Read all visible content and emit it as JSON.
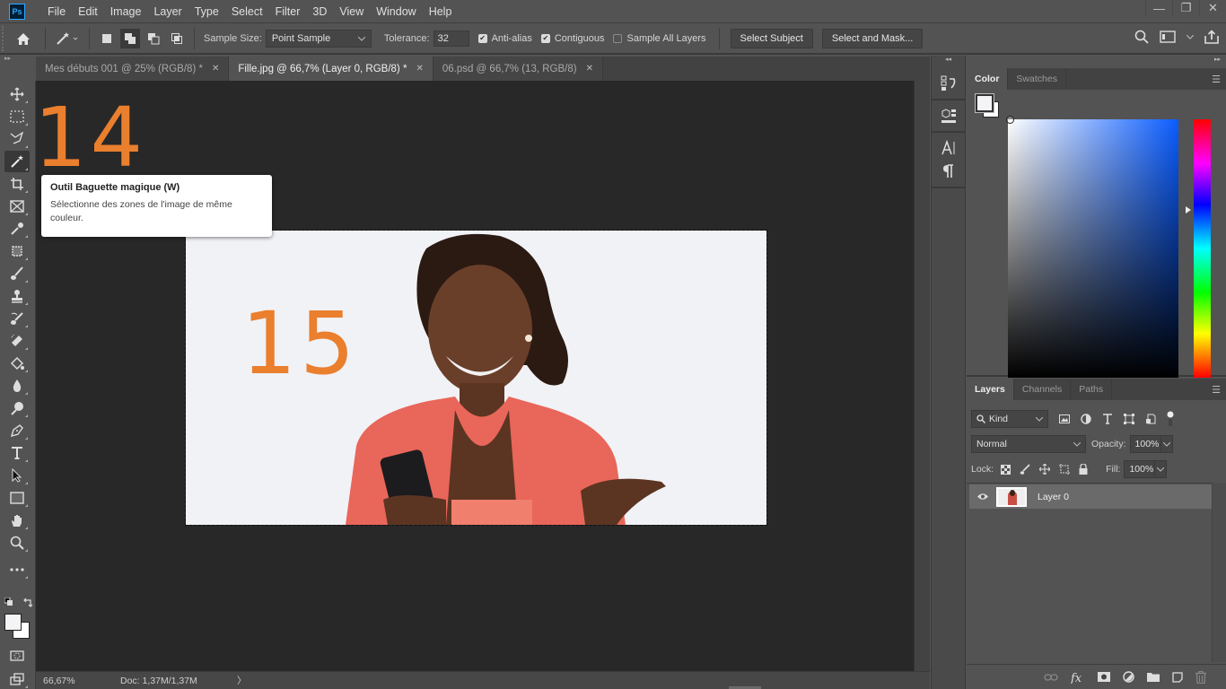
{
  "app": {
    "logo": "Ps"
  },
  "menu": [
    "File",
    "Edit",
    "Image",
    "Layer",
    "Type",
    "Select",
    "Filter",
    "3D",
    "View",
    "Window",
    "Help"
  ],
  "window_controls": {
    "minimize": "—",
    "restore": "❐",
    "close": "✕"
  },
  "options": {
    "sample_size_label": "Sample Size:",
    "sample_size_value": "Point Sample",
    "tolerance_label": "Tolerance:",
    "tolerance_value": "32",
    "anti_alias": {
      "label": "Anti-alias",
      "checked": true
    },
    "contiguous": {
      "label": "Contiguous",
      "checked": true
    },
    "sample_all_layers": {
      "label": "Sample All Layers",
      "checked": false
    },
    "select_subject": "Select Subject",
    "select_and_mask": "Select and Mask..."
  },
  "tabs": [
    {
      "label": "Mes débuts 001 @ 25% (RGB/8) *",
      "active": false,
      "close": "✕"
    },
    {
      "label": "Fille.jpg @ 66,7% (Layer 0, RGB/8) *",
      "active": true,
      "close": "✕"
    },
    {
      "label": "06.psd @ 66,7% (13, RGB/8)",
      "active": false,
      "close": "✕"
    }
  ],
  "annotations": {
    "step_outside": "14",
    "step_inside": "15"
  },
  "tooltip": {
    "title": "Outil Baguette magique (W)",
    "description": "Sélectionne des zones de l'image de même couleur."
  },
  "status": {
    "zoom": "66,67%",
    "doc": "Doc: 1,37M/1,37M",
    "arrow": "〉"
  },
  "color_panel": {
    "tabs": [
      "Color",
      "Swatches"
    ],
    "active_tab": "Color",
    "foreground": "#f4f4f6",
    "background": "#ffffff"
  },
  "layers_panel": {
    "tabs": [
      "Layers",
      "Channels",
      "Paths"
    ],
    "active_tab": "Layers",
    "filter_label": "Kind",
    "blend_mode": "Normal",
    "opacity_label": "Opacity:",
    "opacity_value": "100%",
    "lock_label": "Lock:",
    "fill_label": "Fill:",
    "fill_value": "100%",
    "layers": [
      {
        "name": "Layer 0",
        "visible": true,
        "selected": true
      }
    ]
  }
}
